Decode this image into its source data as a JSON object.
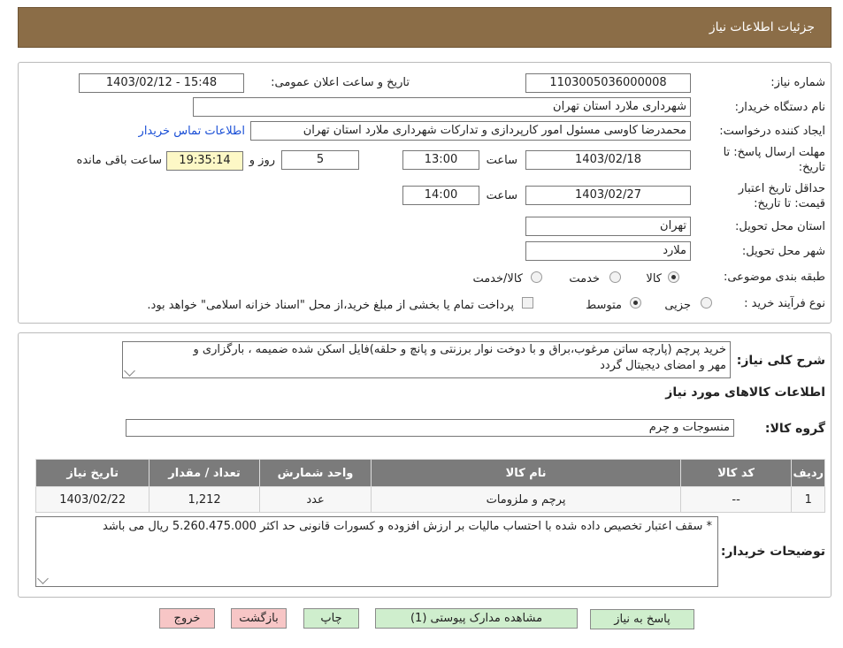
{
  "header": {
    "title": "جزئیات اطلاعات نیاز"
  },
  "form": {
    "need_number_label": "شماره نیاز:",
    "need_number": "1103005036000008",
    "announce_label": "تاریخ و ساعت اعلان عمومی:",
    "announce_value": "1403/02/12 - 15:48",
    "buyer_org_label": "نام دستگاه خریدار:",
    "buyer_org": "شهرداری ملارد استان تهران",
    "requester_label": "ایجاد کننده درخواست:",
    "requester": "محمدرضا کاوسی مسئول امور کارپردازی و تدارکات  شهرداری ملارد استان تهران",
    "contact_link": "اطلاعات تماس خریدار",
    "deadline_label_1": "مهلت ارسال پاسخ: تا",
    "deadline_label_2": "تاریخ:",
    "deadline_date": "1403/02/18",
    "time_label": "ساعت",
    "deadline_time": "13:00",
    "days_value": "5",
    "days_label": "روز و",
    "remaining_time": "19:35:14",
    "remaining_label": "ساعت باقی مانده",
    "validity_label_1": "حداقل تاریخ اعتبار",
    "validity_label_2": "قیمت: تا تاریخ:",
    "validity_date": "1403/02/27",
    "validity_time": "14:00",
    "province_label": "استان محل تحویل:",
    "province": "تهران",
    "city_label": "شهر محل تحویل:",
    "city": "ملارد",
    "category_label": "طبقه بندی موضوعی:",
    "category_options": [
      "کالا",
      "خدمت",
      "کالا/خدمت"
    ],
    "process_label": "نوع فرآیند خرید :",
    "process_options": [
      "جزیی",
      "متوسط"
    ],
    "payment_note": "پرداخت تمام یا بخشی از مبلغ خرید،از محل \"اسناد خزانه اسلامی\" خواهد بود."
  },
  "details": {
    "summary_label": "شرح کلی نیاز:",
    "summary_line1": "خرید پرچم (پارچه ساتن مرغوب،براق و با دوخت نوار برزنتی و پانچ و حلقه)فایل اسکن شده ضمیمه ، بارگزاری و",
    "summary_line2": "مهر و امضای دیجیتال گردد",
    "goods_title": "اطلاعات کالاهای مورد نیاز",
    "group_label": "گروه کالا:",
    "group_value": "منسوجات و چرم",
    "table": {
      "headers": [
        "ردیف",
        "کد کالا",
        "نام کالا",
        "واحد شمارش",
        "تعداد / مقدار",
        "تاریخ نیاز"
      ],
      "rows": [
        {
          "row": "1",
          "code": "--",
          "name": "پرچم و ملزومات",
          "unit": "عدد",
          "qty": "1,212",
          "date": "1403/02/22"
        }
      ]
    },
    "buyer_notes_label": "توضیحات خریدار:",
    "buyer_notes": "* سقف اعتبار تخصیص داده شده با احتساب مالیات بر ارزش افزوده و کسورات قانونی حد اکثر 5.260.475.000 ریال می باشد"
  },
  "buttons": {
    "reply": "پاسخ به نیاز",
    "view_docs": "مشاهده مدارک پیوستی (1)",
    "print": "چاپ",
    "back": "بازگشت",
    "exit": "خروج"
  },
  "colors": {
    "header_bg": "#8b6d47",
    "button_green": "#cfeecd",
    "button_red": "#f7c6c6",
    "link": "#1a4fd6"
  }
}
